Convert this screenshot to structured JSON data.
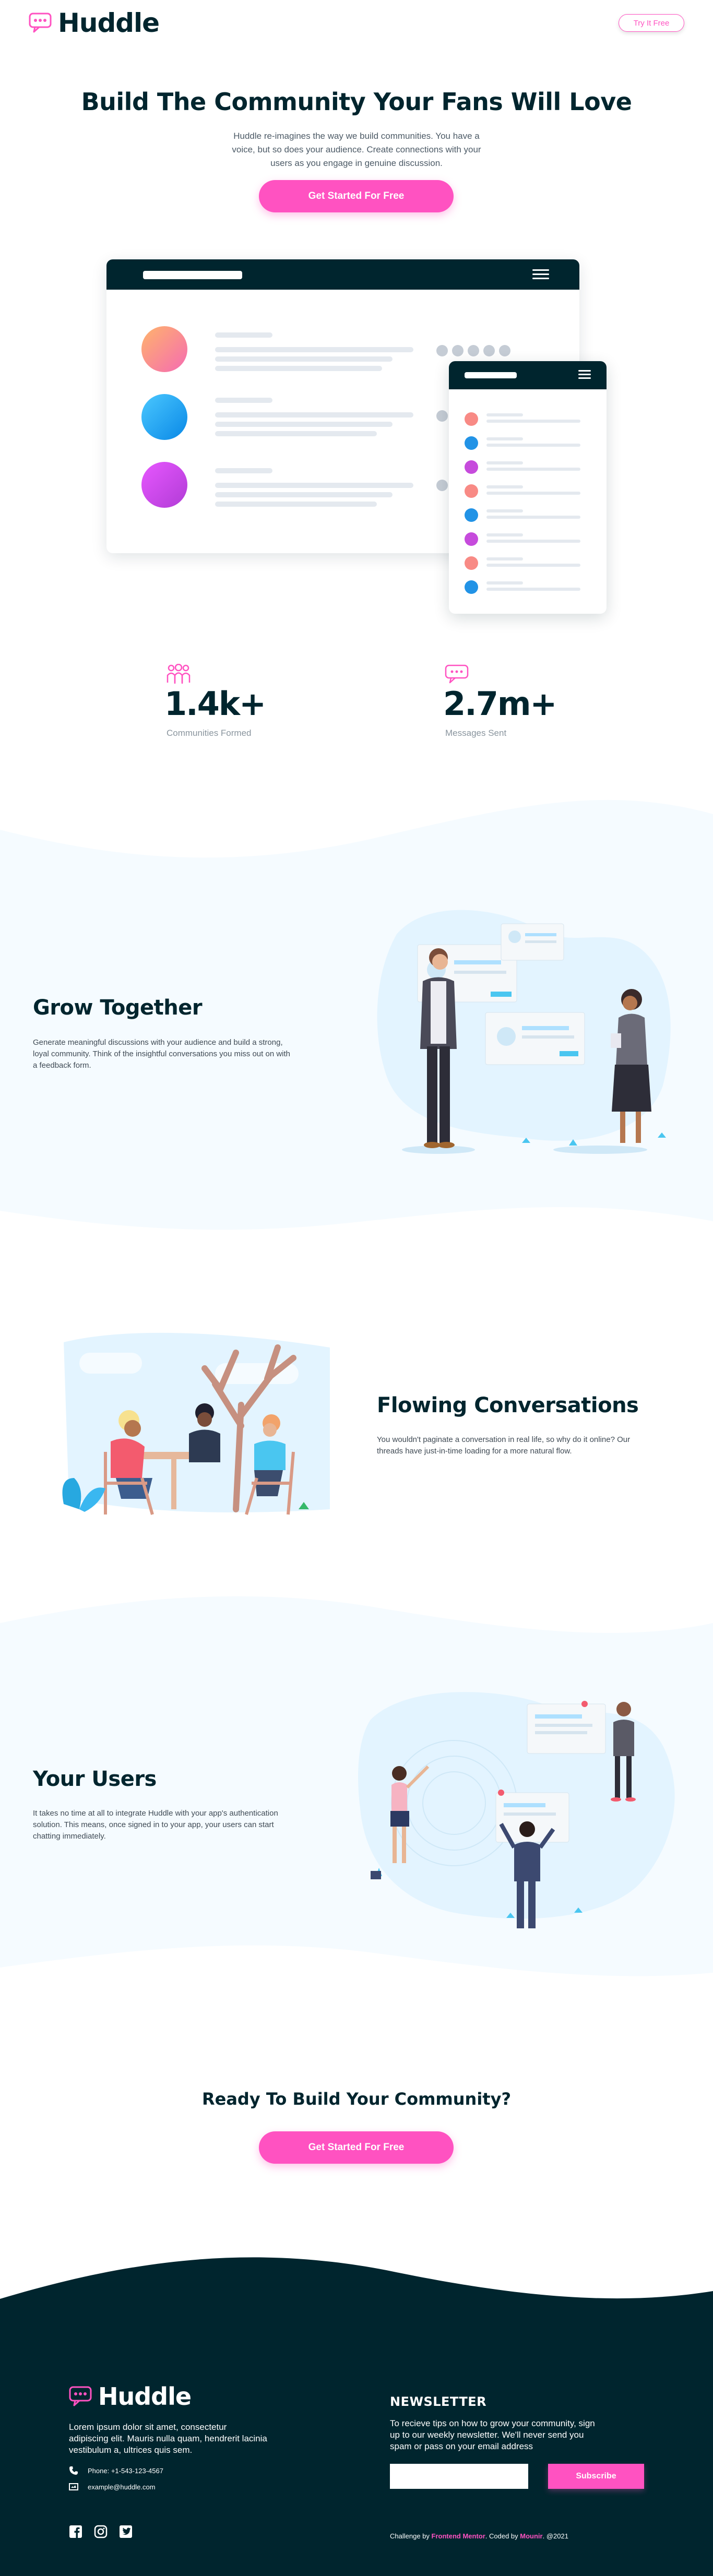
{
  "header": {
    "logo_text": "Huddle",
    "logo_icon": "chat-bubble-icon",
    "try_label": "Try It Free"
  },
  "hero": {
    "title": "Build The Community Your Fans Will Love",
    "description": "Huddle re-imagines the way we build communities. You have a voice, but so does your audience. Create connections with your users as you engage in genuine discussion.",
    "cta_label": "Get Started For Free"
  },
  "stats": [
    {
      "icon": "communities-icon",
      "value": "1.4k+",
      "label": "Communities Formed"
    },
    {
      "icon": "messages-icon",
      "value": "2.7m+",
      "label": "Messages Sent"
    }
  ],
  "features": [
    {
      "title": "Grow Together",
      "text": "Generate meaningful discussions with your audience and build a strong, loyal community. Think of the insightful conversations you miss out on with a feedback form.",
      "illustration": "grow-together-illustration"
    },
    {
      "title": "Flowing Conversations",
      "text": "You wouldn't paginate a conversation in real life, so why do it online? Our threads have just-in-time loading for a more natural flow.",
      "illustration": "flowing-conversation-illustration"
    },
    {
      "title": "Your Users",
      "text": "It takes no time at all to integrate Huddle with your app's authentication solution. This means, once signed in to your app, your users can start chatting immediately.",
      "illustration": "your-users-illustration"
    }
  ],
  "ready": {
    "title": "Ready To Build Your Community?",
    "cta_label": "Get Started For Free"
  },
  "footer": {
    "logo_text": "Huddle",
    "description": "Lorem ipsum dolor sit amet, consectetur adipiscing elit. Mauris nulla quam, hendrerit lacinia vestibulum a, ultrices quis sem.",
    "phone": "Phone: +1-543-123-4567",
    "email": "example@huddle.com",
    "socials": [
      "facebook-icon",
      "instagram-icon",
      "twitter-icon"
    ],
    "newsletter": {
      "title": "NEWSLETTER",
      "text": "To recieve tips on how to grow your community, sign up to our weekly newsletter. We'll never send you spam or pass on your email address",
      "input_value": "",
      "button_label": "Subscribe"
    },
    "credits": {
      "prefix": "Challenge by",
      "challenge_link": "Frontend Mentor",
      "middle": ". Coded by",
      "author_link": "Mounir",
      "suffix": ". @2021"
    }
  },
  "colors": {
    "navy": "#00252e",
    "pink": "#ff52c1",
    "wave": "#f5fbff"
  }
}
